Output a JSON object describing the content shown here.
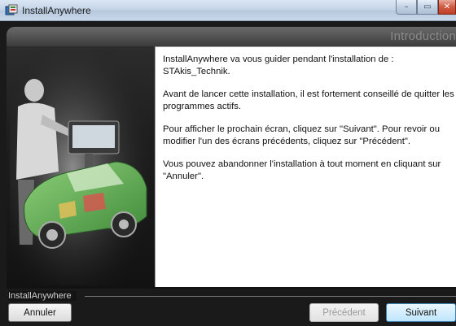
{
  "window": {
    "title": "InstallAnywhere",
    "app_icon": "installanywhere-icon",
    "controls": [
      "minimize-icon",
      "maximize-icon",
      "close-icon"
    ]
  },
  "header": {
    "step_title": "Introduction"
  },
  "content": {
    "paragraphs": [
      "InstallAnywhere va vous guider pendant l'installation de : STAkis_Technik.",
      "Avant de lancer cette installation, il est fortement conseillé de quitter les programmes actifs.",
      "Pour afficher le prochain écran, cliquez sur \"Suivant\". Pour revoir ou modifier l'un des écrans précédents, cliquez sur \"Précédent\".",
      "Vous pouvez abandonner l'installation à tout moment en cliquant sur \"Annuler\"."
    ]
  },
  "footer": {
    "brand": "InstallAnywhere",
    "cancel_label": "Annuler",
    "previous_label": "Précédent",
    "next_label": "Suivant",
    "previous_enabled": false
  },
  "colors": {
    "frame_dark": "#1f1f1f",
    "next_button_border": "#3c7fb1",
    "step_title_text": "#8a8a8a"
  }
}
